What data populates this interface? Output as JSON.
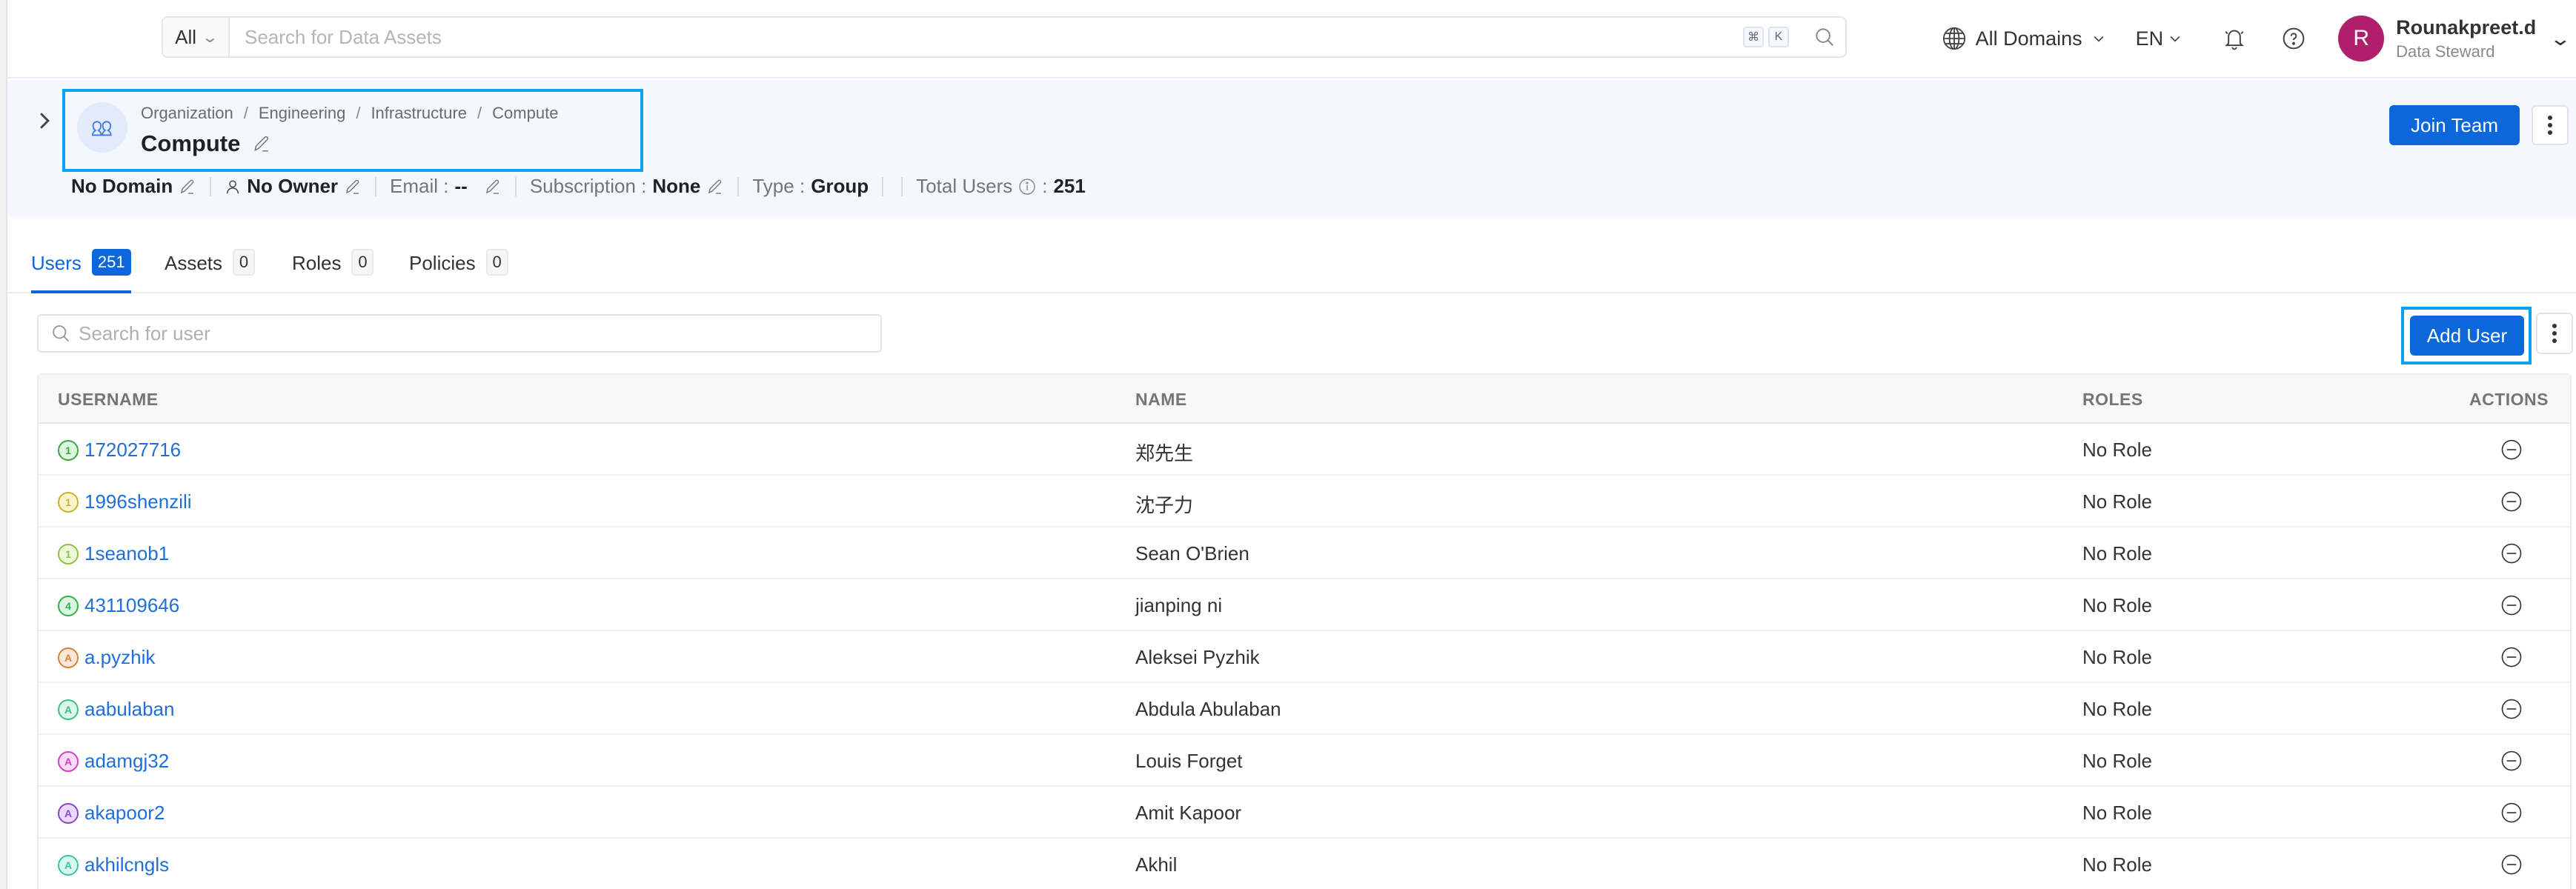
{
  "navbar": {
    "search_filter": "All",
    "search_placeholder": "Search for Data Assets",
    "shortcut_keys": [
      "⌘",
      "K"
    ],
    "domain_selector": "All Domains",
    "language": "EN",
    "user": {
      "initial": "R",
      "name": "Rounakpreet.d",
      "role": "Data Steward",
      "avatar_color": "#b01f6c"
    }
  },
  "header": {
    "breadcrumb": [
      "Organization",
      "Engineering",
      "Infrastructure",
      "Compute"
    ],
    "team_name": "Compute",
    "meta": {
      "domain": "No Domain",
      "owner": "No Owner",
      "email_label": "Email :",
      "email_value": "--",
      "subscription_label": "Subscription :",
      "subscription_value": "None",
      "type_label": "Type :",
      "type_value": "Group",
      "total_users_label": "Total Users",
      "total_users_sep": ":",
      "total_users_value": "251"
    },
    "join_button": "Join Team"
  },
  "tabs": [
    {
      "label": "Users",
      "count": "251",
      "active": true
    },
    {
      "label": "Assets",
      "count": "0",
      "active": false
    },
    {
      "label": "Roles",
      "count": "0",
      "active": false
    },
    {
      "label": "Policies",
      "count": "0",
      "active": false
    }
  ],
  "users_panel": {
    "search_placeholder": "Search for user",
    "add_button": "Add User",
    "columns": [
      "USERNAME",
      "NAME",
      "ROLES",
      "ACTIONS"
    ],
    "rows": [
      {
        "initial": "1",
        "username": "172027716",
        "name": "郑先生",
        "roles": "No Role",
        "avatar_fg": "#3aa845",
        "avatar_bg": "#dcf5dc"
      },
      {
        "initial": "1",
        "username": "1996shenzili",
        "name": "沈子力",
        "roles": "No Role",
        "avatar_fg": "#c9b22c",
        "avatar_bg": "#faf4cc"
      },
      {
        "initial": "1",
        "username": "1seanob1",
        "name": "Sean O'Brien",
        "roles": "No Role",
        "avatar_fg": "#8cc43a",
        "avatar_bg": "#eef8dc"
      },
      {
        "initial": "4",
        "username": "431109646",
        "name": "jianping ni",
        "roles": "No Role",
        "avatar_fg": "#35b04a",
        "avatar_bg": "#dcf5e0"
      },
      {
        "initial": "A",
        "username": "a.pyzhik",
        "name": "Aleksei Pyzhik",
        "roles": "No Role",
        "avatar_fg": "#d5843a",
        "avatar_bg": "#fbe8d6"
      },
      {
        "initial": "A",
        "username": "aabulaban",
        "name": "Abdula Abulaban",
        "roles": "No Role",
        "avatar_fg": "#3fbf82",
        "avatar_bg": "#dcf6ea"
      },
      {
        "initial": "A",
        "username": "adamgj32",
        "name": "Louis Forget",
        "roles": "No Role",
        "avatar_fg": "#d43fc7",
        "avatar_bg": "#fadcf6"
      },
      {
        "initial": "A",
        "username": "akapoor2",
        "name": "Amit Kapoor",
        "roles": "No Role",
        "avatar_fg": "#8a47c9",
        "avatar_bg": "#ead9f8"
      },
      {
        "initial": "A",
        "username": "akhilcngls",
        "name": "Akhil",
        "roles": "No Role",
        "avatar_fg": "#3cc3a4",
        "avatar_bg": "#d8f7ef"
      }
    ]
  },
  "colors": {
    "primary": "#0b67da",
    "highlight_frame": "#0aa1f0",
    "header_band": "#f4f8fe",
    "link": "#1e6fd9"
  }
}
